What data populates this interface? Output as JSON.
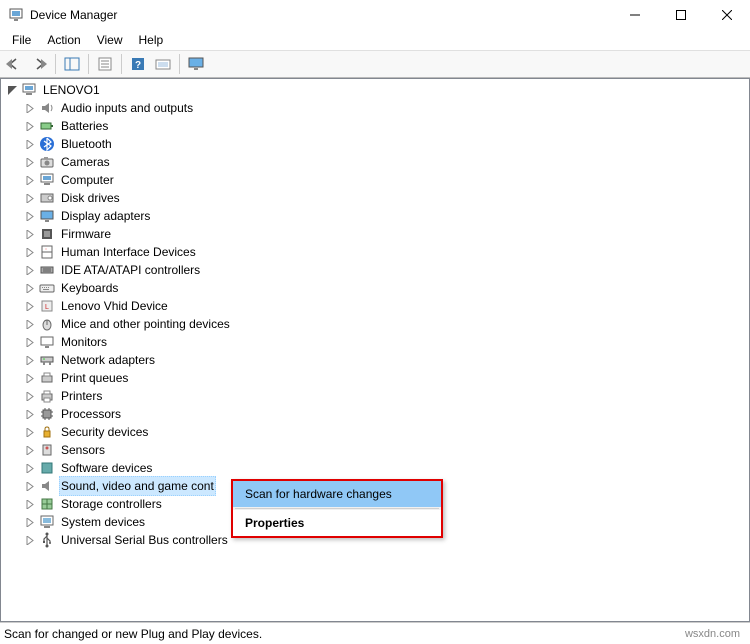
{
  "window": {
    "title": "Device Manager"
  },
  "menu": {
    "file": "File",
    "action": "Action",
    "view": "View",
    "help": "Help"
  },
  "tree": {
    "root": "LENOVO1",
    "items": [
      "Audio inputs and outputs",
      "Batteries",
      "Bluetooth",
      "Cameras",
      "Computer",
      "Disk drives",
      "Display adapters",
      "Firmware",
      "Human Interface Devices",
      "IDE ATA/ATAPI controllers",
      "Keyboards",
      "Lenovo Vhid Device",
      "Mice and other pointing devices",
      "Monitors",
      "Network adapters",
      "Print queues",
      "Printers",
      "Processors",
      "Security devices",
      "Sensors",
      "Software devices",
      "Sound, video and game cont",
      "Storage controllers",
      "System devices",
      "Universal Serial Bus controllers"
    ]
  },
  "context_menu": {
    "scan": "Scan for hardware changes",
    "properties": "Properties"
  },
  "status": {
    "text": "Scan for changed or new Plug and Play devices.",
    "brand": "wsxdn.com"
  }
}
